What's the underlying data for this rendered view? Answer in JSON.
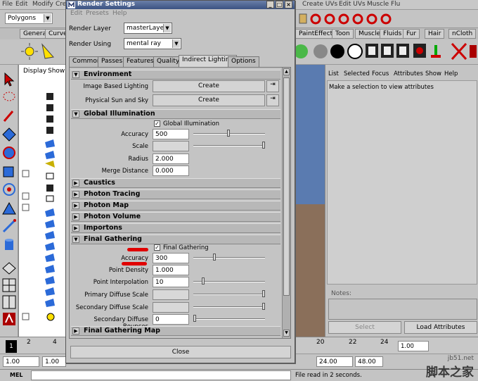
{
  "maya": {
    "menus": [
      "File",
      "Edit",
      "Modify",
      "Cre"
    ],
    "menus_right": [
      "Create UVs",
      "Edit UVs",
      "Muscle",
      "Flu"
    ],
    "mode": "Polygons",
    "shelf_tabs_left": [
      "General",
      "Curve"
    ],
    "shelf_tabs_right": [
      "PaintEffects",
      "Toon",
      "Muscle",
      "Fluids",
      "Fur",
      "Hair",
      "nCloth"
    ],
    "outliner_menu": [
      "Display",
      "Show"
    ],
    "attr_menu": [
      "List",
      "Selected",
      "Focus",
      "Attributes",
      "Show",
      "Help"
    ],
    "attr_message": "Make a selection to view attributes",
    "notes_label": "Notes:",
    "select_button": "Select",
    "load_attributes_button": "Load Attributes",
    "timeline_ticks_left": [
      "1",
      "2",
      "4"
    ],
    "timeline_ticks_right": [
      "20",
      "22",
      "24"
    ],
    "range_start": "1.00",
    "range_start2": "1.00",
    "range_end": "24.00",
    "range_end2": "48.00",
    "range_right": "1.00",
    "cmd_label": "MEL",
    "status_message": "File read in 2 seconds."
  },
  "render_settings": {
    "title": "Render Settings",
    "menu": [
      "Edit",
      "Presets",
      "Help"
    ],
    "render_layer_label": "Render Layer",
    "render_layer_value": "masterLayer",
    "render_using_label": "Render Using",
    "render_using_value": "mental ray",
    "tabs": [
      "Common",
      "Passes",
      "Features",
      "Quality",
      "Indirect Lighting",
      "Options"
    ],
    "active_tab": "Indirect Lighting",
    "environment": {
      "title": "Environment",
      "ibl_label": "Image Based Lighting",
      "ibl_button": "Create",
      "sun_label": "Physical Sun and Sky",
      "sun_button": "Create"
    },
    "global_illumination": {
      "title": "Global Illumination",
      "checkbox_label": "Global Illumination",
      "accuracy_label": "Accuracy",
      "accuracy_value": "500",
      "accuracy_fraction": 0.5,
      "scale_label": "Scale",
      "radius_label": "Radius",
      "radius_value": "2.000",
      "merge_label": "Merge Distance",
      "merge_value": "0.000"
    },
    "collapsed_sections": [
      "Caustics",
      "Photon Tracing",
      "Photon Map",
      "Photon Volume",
      "Importons"
    ],
    "final_gathering": {
      "title": "Final Gathering",
      "checkbox_label": "Final Gathering",
      "accuracy_label": "Accuracy",
      "accuracy_value": "300",
      "point_density_label": "Point Density",
      "point_density_value": "1.000",
      "point_interp_label": "Point Interpolation",
      "point_interp_value": "10",
      "primary_diffuse_label": "Primary Diffuse Scale",
      "secondary_diffuse_label": "Secondary Diffuse Scale",
      "secondary_bounces_label": "Secondary Diffuse Bounces",
      "secondary_bounces_value": "0"
    },
    "fg_map_title": "Final Gathering Map",
    "close_button": "Close"
  },
  "watermark": {
    "line1": "jb51.net",
    "line2": "脚本之家"
  },
  "colors": {
    "title_gradient_top": "#6a7fa8",
    "title_gradient_bottom": "#3b5282",
    "highlight_red": "#e00000",
    "viewport_sky": "#5a7bb0",
    "viewport_ground": "#8a6f5a"
  }
}
